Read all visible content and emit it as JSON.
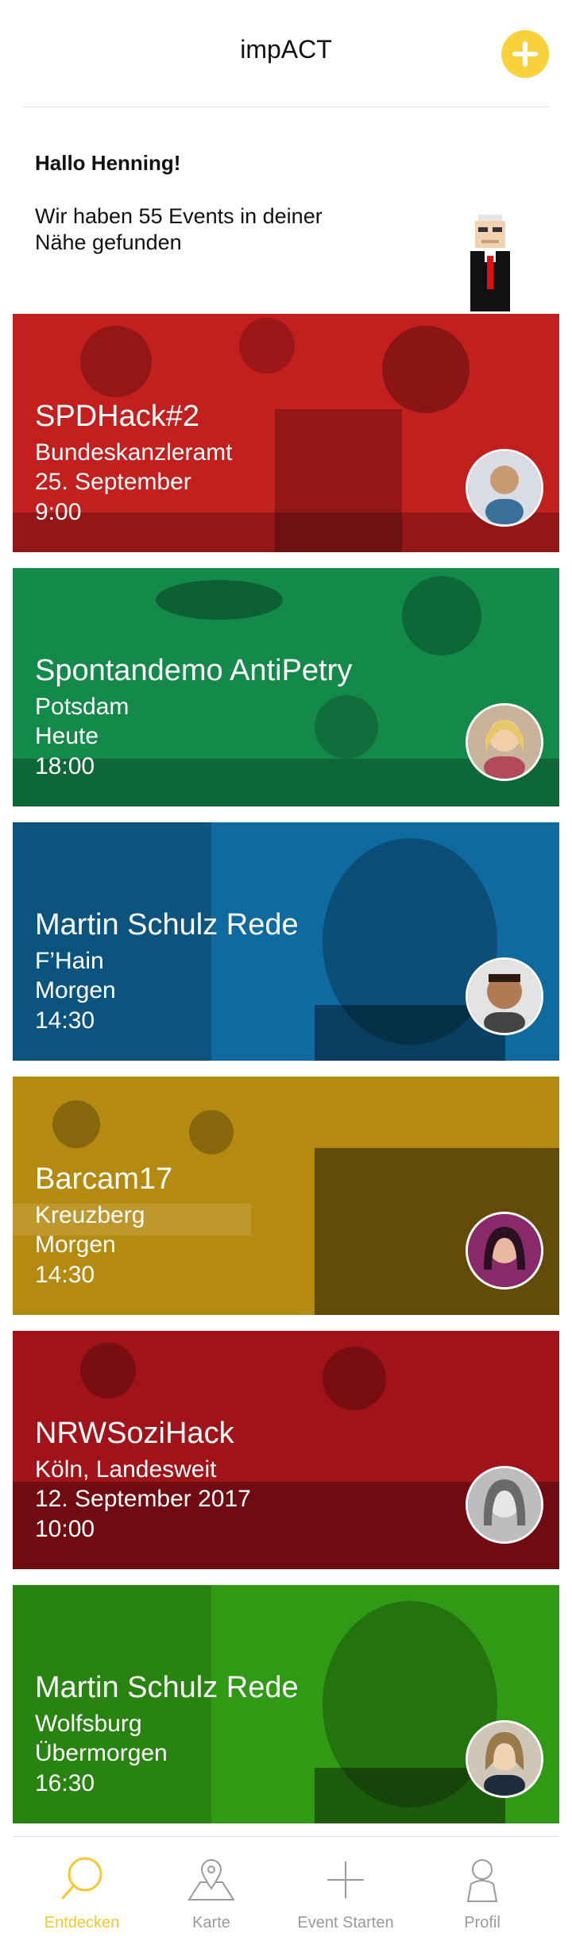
{
  "header": {
    "title": "impACT",
    "add_icon": "plus-icon"
  },
  "intro": {
    "greeting": "Hallo Henning!",
    "events_found": "Wir haben 55 Events in deiner Nähe gefunden"
  },
  "events": [
    {
      "title": "SPDHack#2",
      "location": "Bundeskanzleramt",
      "date": "25. September",
      "time": "9:00",
      "tint": "#c41f1f"
    },
    {
      "title": "Spontandemo AntiPetry",
      "location": "Potsdam",
      "date": "Heute",
      "time": "18:00",
      "tint": "#138a4a"
    },
    {
      "title": "Martin Schulz Rede",
      "location": "F’Hain",
      "date": "Morgen",
      "time": "14:30",
      "tint": "#0f6aa0"
    },
    {
      "title": "Barcam17",
      "location": "Kreuzberg",
      "date": "Morgen",
      "time": "14:30",
      "tint": "#b58a10"
    },
    {
      "title": "NRWSoziHack",
      "location": "Köln, Landesweit",
      "date": "12. September 2017",
      "time": "10:00",
      "tint": "#a11219"
    },
    {
      "title": "Martin Schulz Rede",
      "location": "Wolfsburg",
      "date": "Übermorgen",
      "time": "16:30",
      "tint": "#2f9a14"
    }
  ],
  "tabbar": {
    "active_color": "#f2c92f",
    "tabs": [
      {
        "label": "Entdecken",
        "icon": "magnifier-icon",
        "active": true
      },
      {
        "label": "Karte",
        "icon": "map-icon",
        "active": false
      },
      {
        "label": "Event Starten",
        "icon": "plus-icon",
        "active": false
      },
      {
        "label": "Profil",
        "icon": "person-icon",
        "active": false
      }
    ]
  }
}
